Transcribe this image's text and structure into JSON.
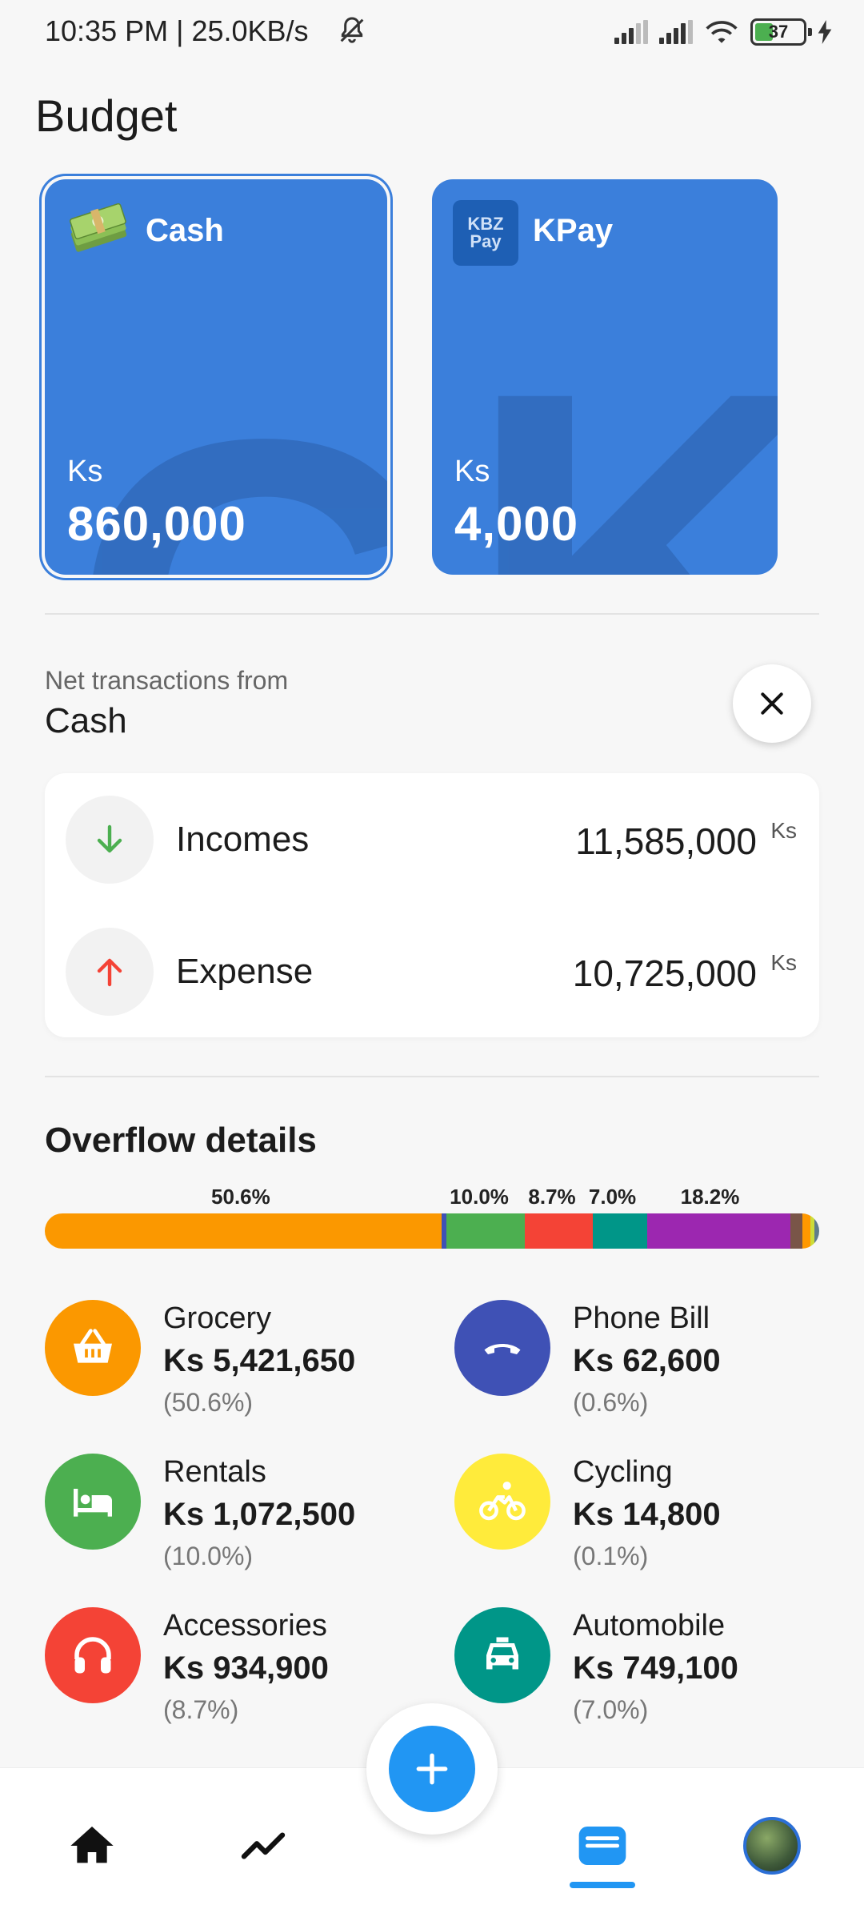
{
  "status_bar": {
    "time": "10:35 PM | 25.0KB/s",
    "battery": "37"
  },
  "page": {
    "title": "Budget"
  },
  "wallets": [
    {
      "name": "Cash",
      "currency": "Ks",
      "amount": "860,000",
      "icon": "cash-money-icon",
      "watermark": "C",
      "selected": true
    },
    {
      "name": "KPay",
      "currency": "Ks",
      "amount": "4,000",
      "icon": "kbz-pay-logo",
      "logo_text": "KBZ Pay",
      "watermark": "K",
      "selected": false
    }
  ],
  "net": {
    "label": "Net transactions from",
    "wallet": "Cash"
  },
  "summary": {
    "income": {
      "label": "Incomes",
      "value": "11,585,000",
      "unit": "Ks",
      "color": "#4caf50"
    },
    "expense": {
      "label": "Expense",
      "value": "10,725,000",
      "unit": "Ks",
      "color": "#f44336"
    }
  },
  "overflow": {
    "title": "Overflow details",
    "bar_labels": [
      "50.6%",
      "10.0%",
      "8.7%",
      "7.0%",
      "18.2%"
    ],
    "segments": [
      {
        "percent": 50.6,
        "color": "#fb9800"
      },
      {
        "percent": 0.6,
        "color": "#3f51b5"
      },
      {
        "percent": 10.0,
        "color": "#4caf50"
      },
      {
        "percent": 8.7,
        "color": "#f44336"
      },
      {
        "percent": 7.0,
        "color": "#009688"
      },
      {
        "percent": 18.2,
        "color": "#9c27b0"
      },
      {
        "percent": 1.6,
        "color": "#795548"
      },
      {
        "percent": 1.0,
        "color": "#ff9800"
      },
      {
        "percent": 0.5,
        "color": "#cddc39"
      },
      {
        "percent": 0.6,
        "color": "#607d8b"
      }
    ],
    "categories": [
      {
        "name": "Grocery",
        "amount": "Ks 5,421,650",
        "percent": "(50.6%)",
        "color": "#fb9800",
        "icon": "basket-icon"
      },
      {
        "name": "Phone Bill",
        "amount": "Ks 62,600",
        "percent": "(0.6%)",
        "color": "#3f51b5",
        "icon": "phone-icon"
      },
      {
        "name": "Rentals",
        "amount": "Ks 1,072,500",
        "percent": "(10.0%)",
        "color": "#4caf50",
        "icon": "bed-icon"
      },
      {
        "name": "Cycling",
        "amount": "Ks 14,800",
        "percent": "(0.1%)",
        "color": "#ffeb3b",
        "icon": "cycling-icon"
      },
      {
        "name": "Accessories",
        "amount": "Ks 934,900",
        "percent": "(8.7%)",
        "color": "#f44336",
        "icon": "headphones-icon"
      },
      {
        "name": "Automobile",
        "amount": "Ks 749,100",
        "percent": "(7.0%)",
        "color": "#009688",
        "icon": "taxi-icon"
      }
    ]
  },
  "bottom_nav": {
    "items": [
      "home-icon",
      "trending-icon",
      "wallet-icon",
      "avatar"
    ],
    "active": "wallet-icon",
    "fab_icon": "plus-icon",
    "accent": "#2196f3"
  }
}
